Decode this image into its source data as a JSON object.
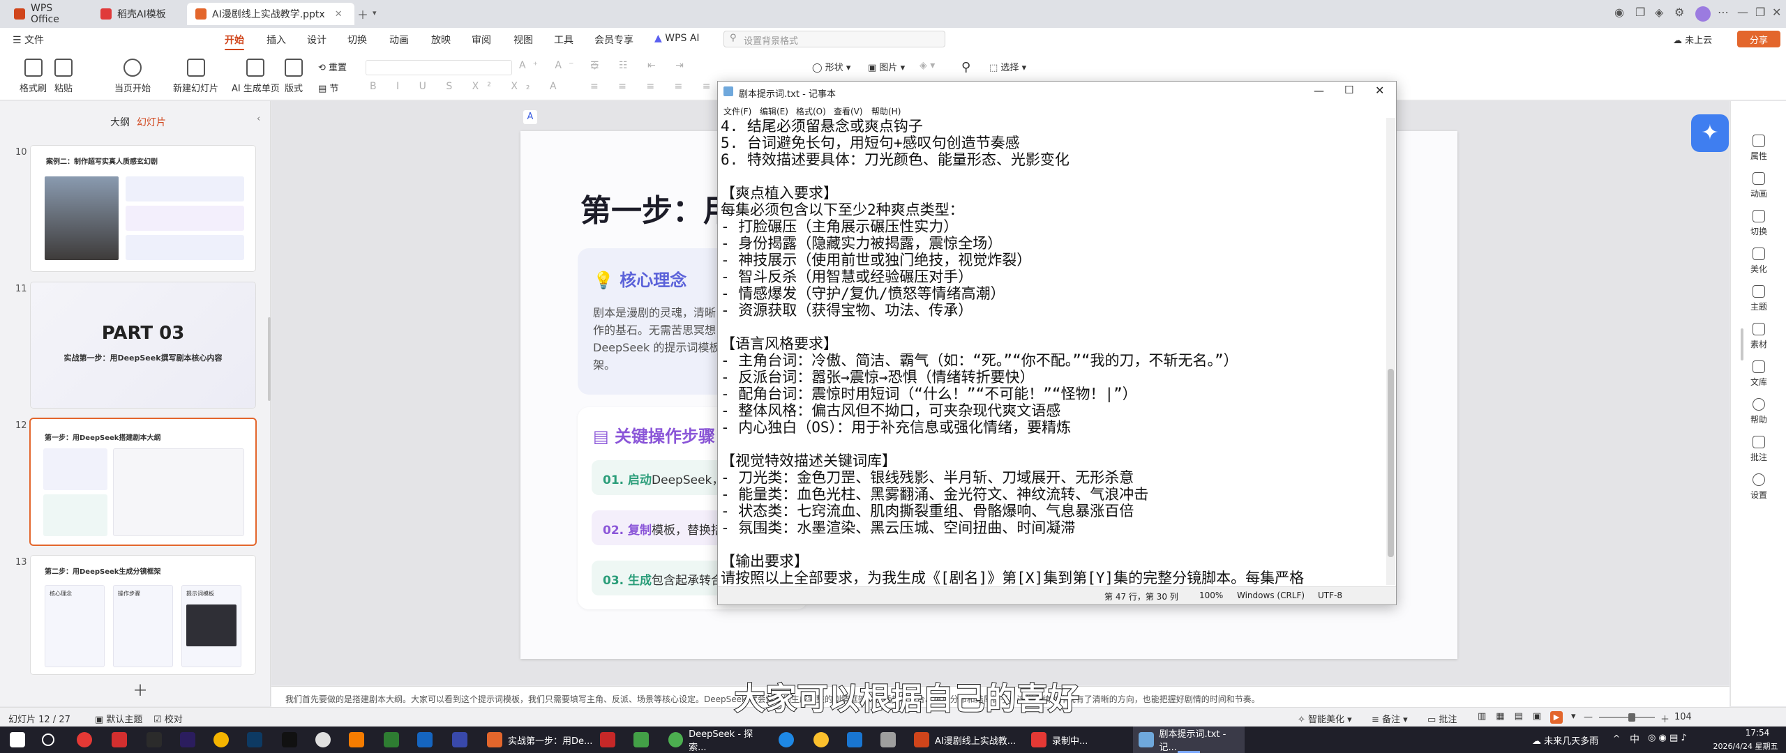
{
  "tabs": [
    {
      "label": "WPS Office",
      "color": "#d0451b"
    },
    {
      "label": "稻壳AI模板",
      "color": "#e03b3b"
    },
    {
      "label": "AI漫剧线上实战教学.pptx",
      "color": "#e3662c"
    }
  ],
  "menu": {
    "file": "文件",
    "items": [
      "开始",
      "插入",
      "设计",
      "切换",
      "动画",
      "放映",
      "审阅",
      "视图",
      "工具",
      "会员专享"
    ],
    "wps_ai": "WPS AI",
    "search_placeholder": "设置背景格式",
    "cloud": "未上云",
    "share": "分享"
  },
  "toolbar": {
    "format_painter": "格式刷",
    "paste": "粘贴",
    "from_start": "当页开始",
    "new_slide": "新建幻灯片",
    "ai_slide": "AI 生成单页",
    "layout": "版式",
    "section": "节",
    "reset": "重置",
    "shape": "形状",
    "picture": "图片",
    "select": "选择"
  },
  "left_panel": {
    "tab_outline": "大纲",
    "tab_slides": "幻灯片",
    "slides": [
      {
        "num": "10",
        "title": "案例二：制作超写实真人质感玄幻剧"
      },
      {
        "num": "11",
        "title": "PART 03",
        "subtitle": "实战第一步：用DeepSeek撰写剧本核心内容"
      },
      {
        "num": "12",
        "title": "第一步：用DeepSeek搭建剧本大纲"
      },
      {
        "num": "13",
        "title": "第二步：用DeepSeek生成分镜框架",
        "cards": [
          "核心理念",
          "操作步骤",
          "提示词模板"
        ]
      }
    ]
  },
  "slide": {
    "title": "第一步：用",
    "core_title": "核心理念",
    "core_text": "剧本是漫剧的灵魂，清晰\n作的基石。无需苦思冥想\nDeepSeek 的提示词模板\n架。",
    "steps_title": "关键操作步骤",
    "steps": [
      {
        "num": "01. 启动",
        "text": "DeepSeek，进"
      },
      {
        "num": "02. 复制",
        "text": "模板，替换括"
      },
      {
        "num": "03. 生成",
        "text": "包含起承转合"
      }
    ]
  },
  "notepad": {
    "title": "剧本提示词.txt - 记事本",
    "menu": [
      "文件(F)",
      "编辑(E)",
      "格式(O)",
      "查看(V)",
      "帮助(H)"
    ],
    "lines": [
      "4. 结尾必须留悬念或爽点钩子",
      "5. 台词避免长句，用短句+感叹句创造节奏感",
      "6. 特效描述要具体：刀光颜色、能量形态、光影变化",
      "",
      "【爽点植入要求】",
      "每集必须包含以下至少2种爽点类型：",
      "- 打脸碾压（主角展示碾压性实力）",
      "- 身份揭露（隐藏实力被揭露，震惊全场）",
      "- 神技展示（使用前世或独门绝技，视觉炸裂）",
      "- 智斗反杀（用智慧或经验碾压对手）",
      "- 情感爆发（守护/复仇/愤怒等情绪高潮）",
      "- 资源获取（获得宝物、功法、传承）",
      "",
      "【语言风格要求】",
      "- 主角台词：冷傲、简洁、霸气（如：“死。”“你不配。”“我的刀，不斩无名。”）",
      "- 反派台词：嚣张→震惊→恐惧（情绪转折要快）",
      "- 配角台词：震惊时用短词（“什么！”“不可能！”“怪物！|”）",
      "- 整体风格：偏古风但不拗口，可夹杂现代爽文语感",
      "- 内心独白（OS）：用于补充信息或强化情绪，要精炼",
      "",
      "【视觉特效描述关键词库】",
      "- 刀光类：金色刀罡、银线残影、半月斩、刀域展开、无形杀意",
      "- 能量类：血色光柱、黑雾翻涌、金光符文、神纹流转、气浪冲击",
      "- 状态类：七窍流血、肌肉撕裂重组、骨骼爆响、气息暴涨百倍",
      "- 氛围类：水墨渲染、黑云压城、空间扭曲、时间凝滞",
      "",
      "【输出要求】",
      "请按照以上全部要求，为我生成《[剧名]》第[X]集到第[Y]集的完整分镜脚本。每集严格"
    ],
    "status": {
      "position": "第 47 行，第 30 列",
      "zoom": "100%",
      "eol": "Windows (CRLF)",
      "encoding": "UTF-8"
    }
  },
  "right_bar": [
    "属性",
    "动画",
    "切换",
    "美化",
    "主题",
    "素材",
    "文库",
    "帮助",
    "批注",
    "设置"
  ],
  "notes_text": "我们首先要做的是搭建剧本大纲。大家可以看到这个提示词模板，我们只需要填写主角、反派、场景等核心设定。DeepSeek 就会帮我们生成完整的剧情框架，包括起承转合、爽点分布和结尾钩子，这样后续创作就有了清晰的方向，也能把握好剧情的时间和节奏。",
  "statusbar": {
    "slide_pos": "幻灯片 12 / 27",
    "theme": "默认主题",
    "proof": "校对",
    "smart": "智能美化",
    "notes": "备注",
    "comments": "批注",
    "zoom": "104"
  },
  "taskbar": {
    "apps": [
      "实战第一步：用De...",
      "DeepSeek - 探索...",
      "AI漫剧线上实战教...",
      "录制中...",
      "剧本提示词.txt - 记..."
    ],
    "weather": "未来几天多雨",
    "time": "17:54",
    "date": "2026/4/24 星期五",
    "ime": "中"
  },
  "subtitle": "大家可以根据自己的喜好"
}
